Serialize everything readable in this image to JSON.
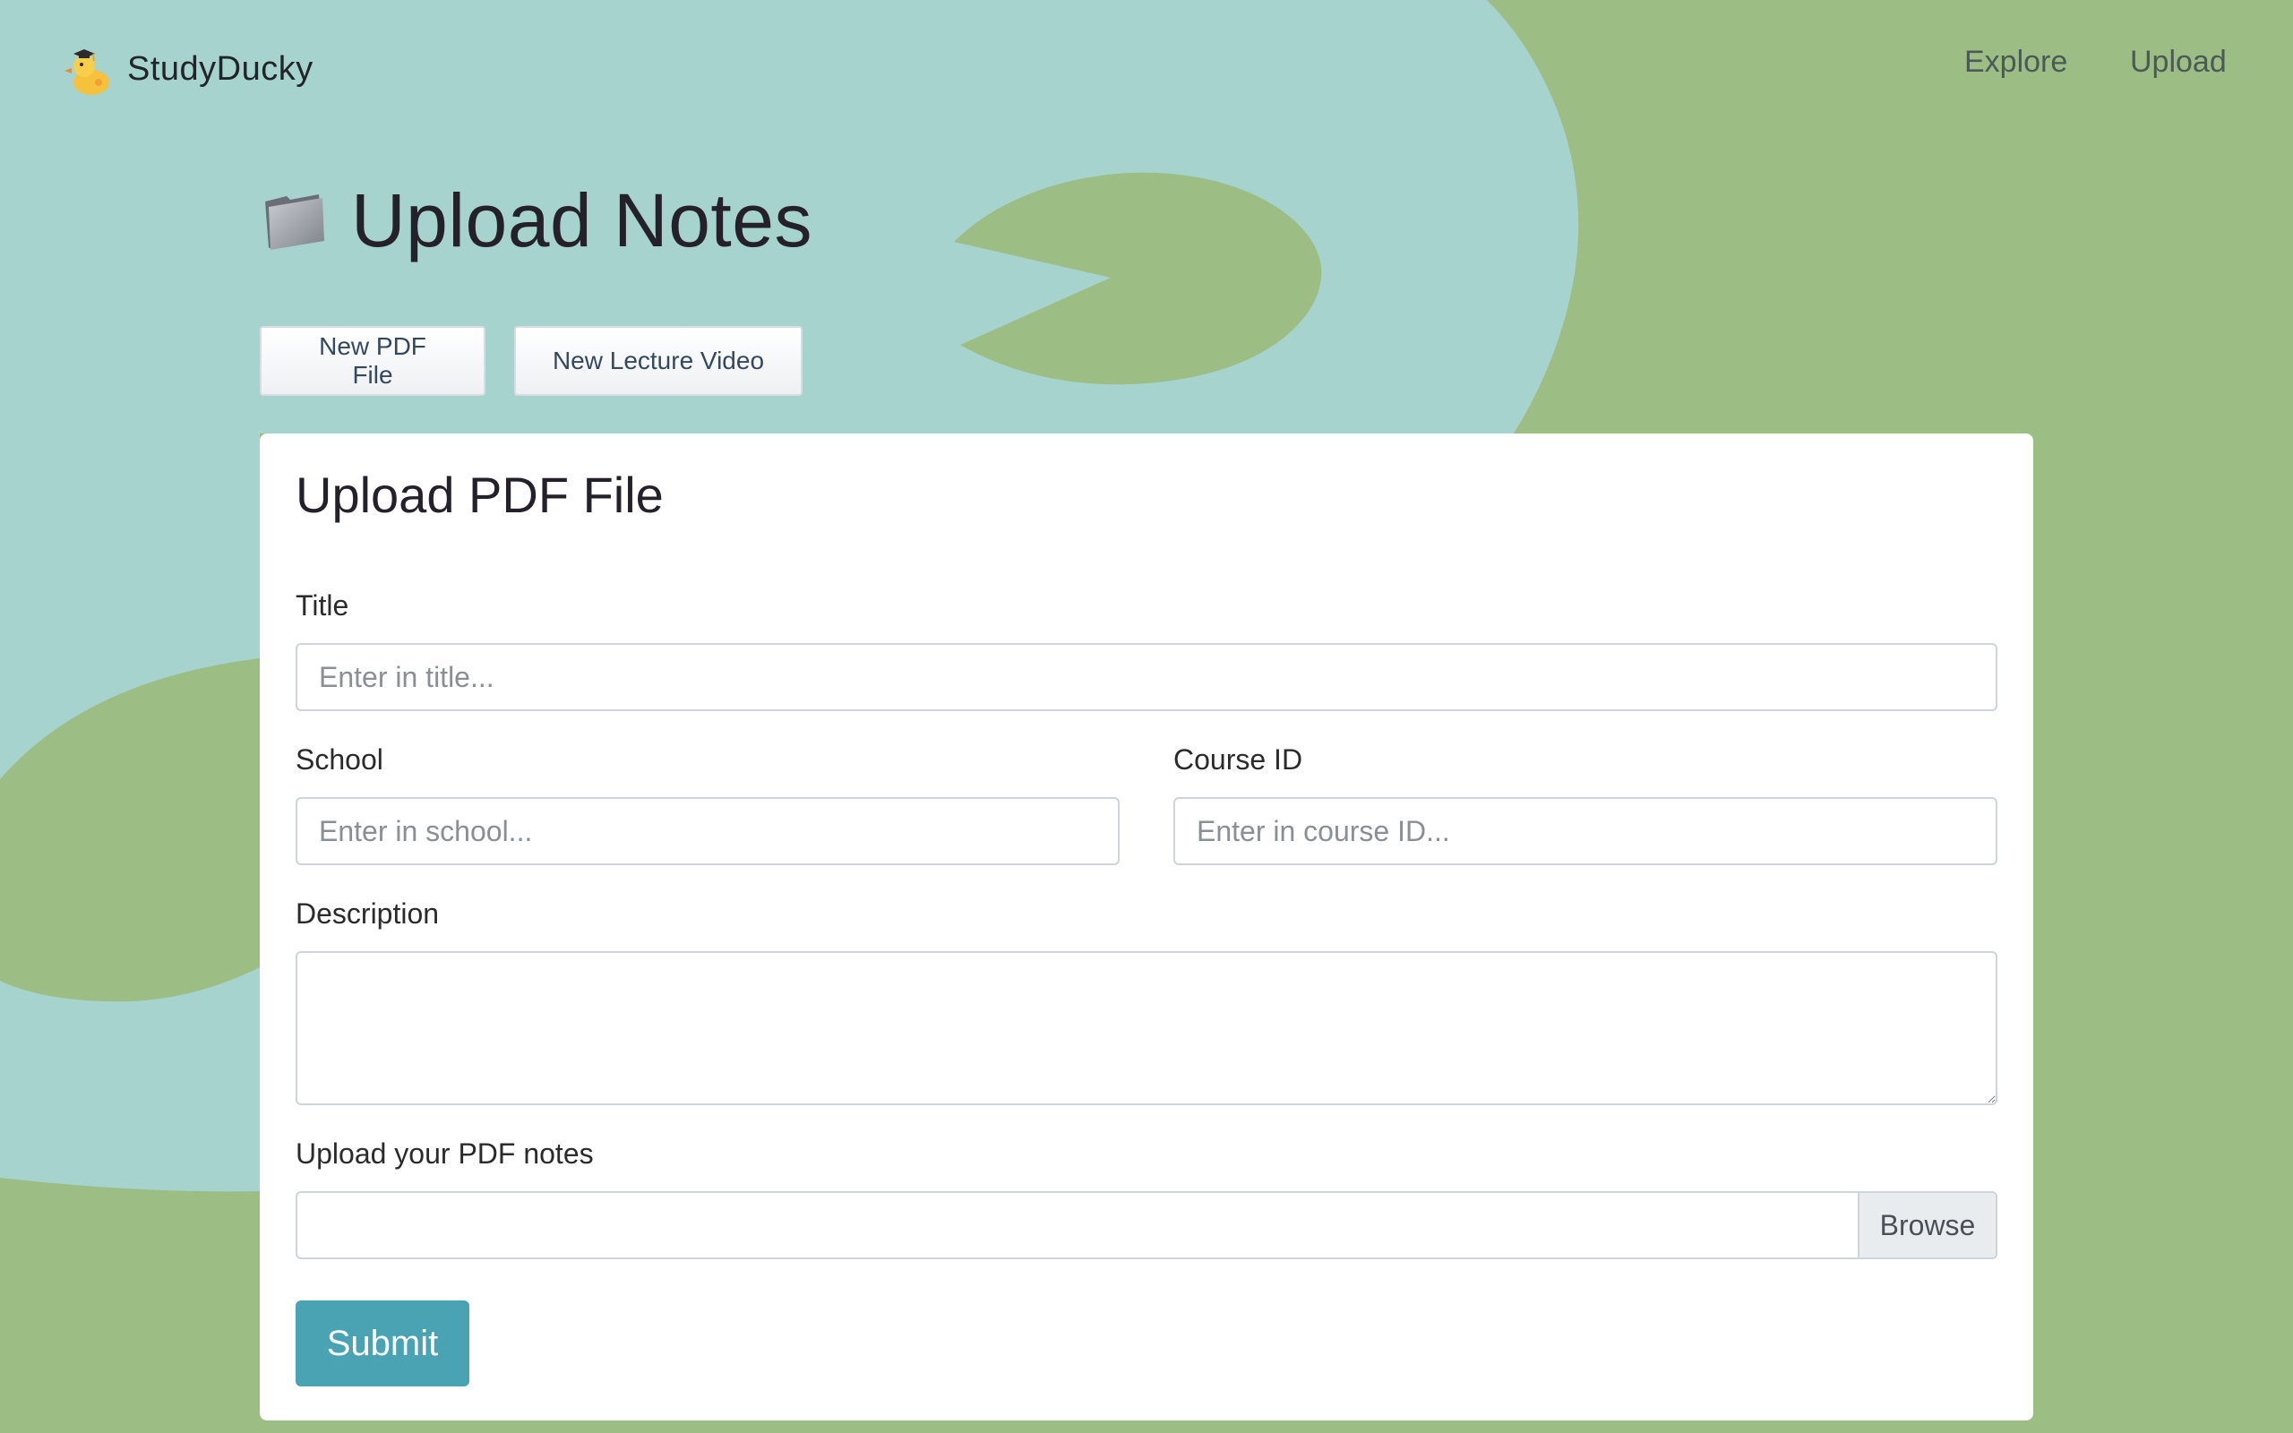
{
  "brand": {
    "name": "StudyDucky"
  },
  "nav": {
    "explore": "Explore",
    "upload": "Upload"
  },
  "page": {
    "title": "Upload Notes"
  },
  "toggle": {
    "pdf_label": "New PDF File",
    "video_label": "New Lecture Video"
  },
  "form": {
    "heading": "Upload PDF File",
    "title_label": "Title",
    "title_placeholder": "Enter in title...",
    "school_label": "School",
    "school_placeholder": "Enter in school...",
    "course_label": "Course ID",
    "course_placeholder": "Enter in course ID...",
    "description_label": "Description",
    "upload_label": "Upload your PDF notes",
    "browse_label": "Browse",
    "submit_label": "Submit"
  },
  "colors": {
    "background_green": "#9cbe84",
    "background_teal": "#a7d3cf",
    "submit_button": "#4aa3b3"
  },
  "icons": {
    "brand": "duck-with-graduation-cap-icon",
    "heading": "folder-icon"
  }
}
